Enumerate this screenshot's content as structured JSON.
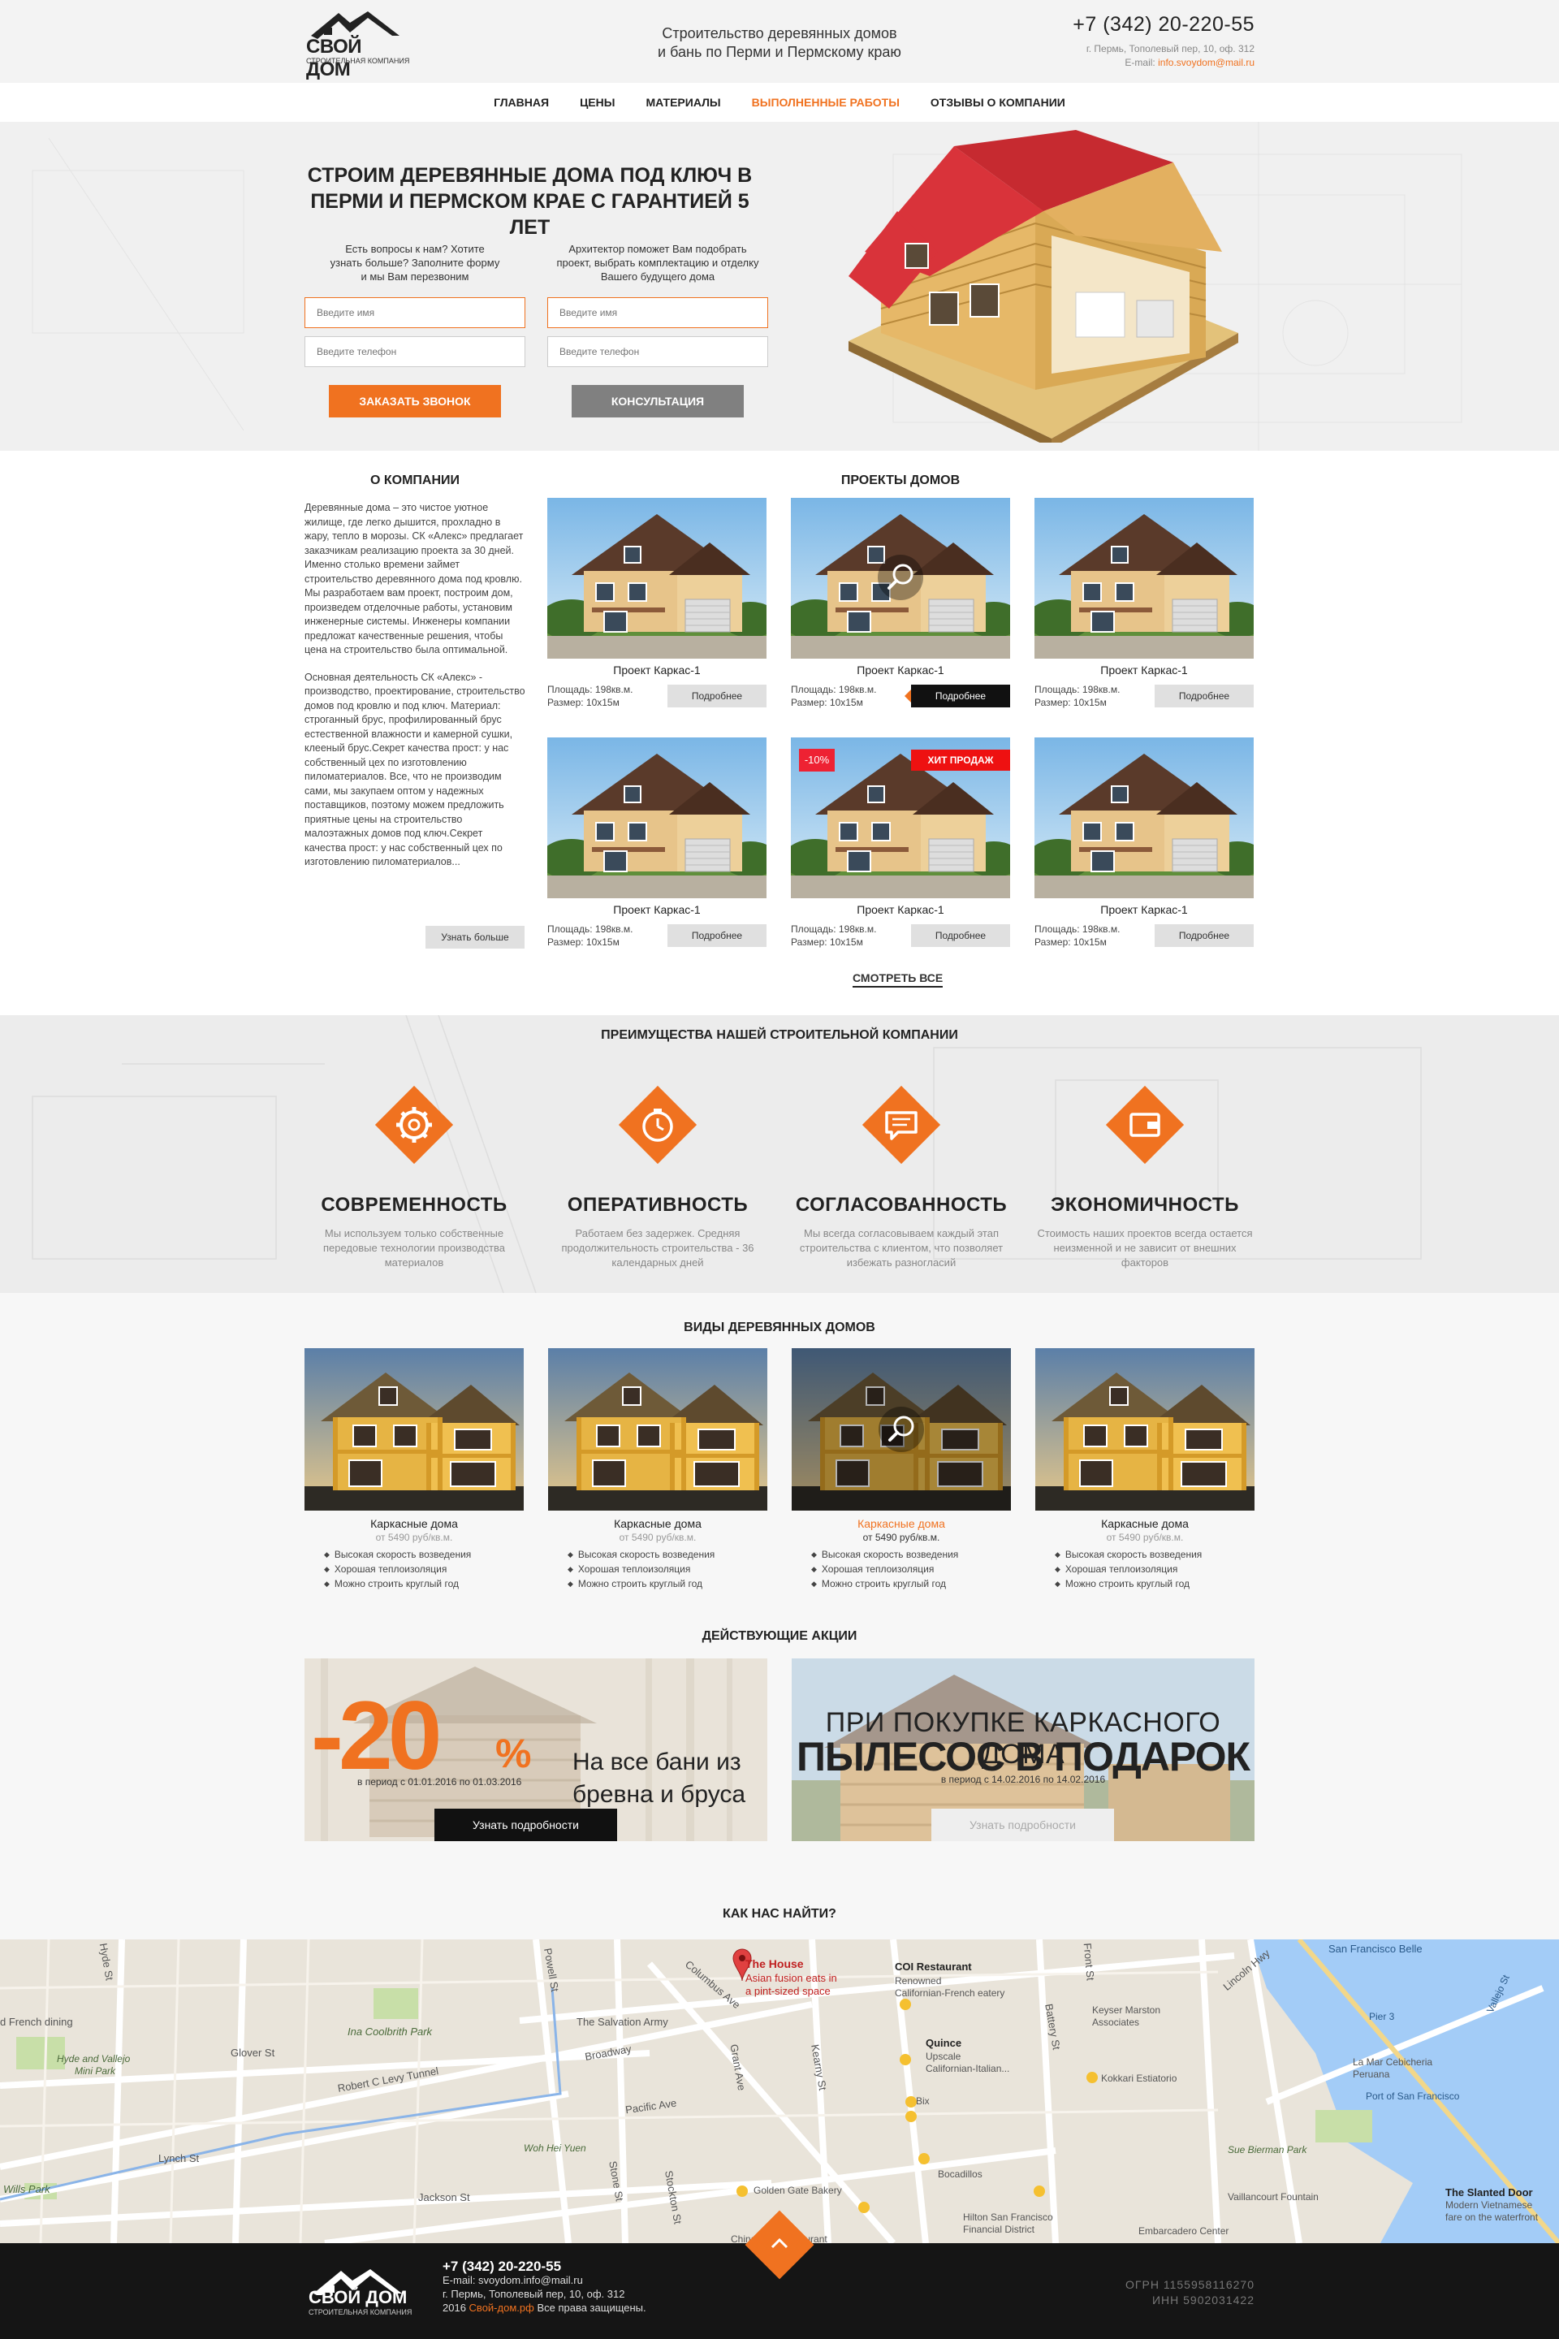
{
  "header": {
    "logo_top": "СВОЙ ДОМ",
    "logo_sub": "СТРОИТЕЛЬНАЯ КОМПАНИЯ",
    "tagline_line1": "Строительство деревянных домов",
    "tagline_line2": "и бань по Перми и Пермскому краю",
    "phone": "+7 (342) 20-220-55",
    "address": "г. Пермь, Тополевый пер, 10, оф. 312",
    "email_label": "E-mail:",
    "email": "info.svoydom@mail.ru"
  },
  "nav": {
    "items": [
      "ГЛАВНАЯ",
      "ЦЕНЫ",
      "МАТЕРИАЛЫ",
      "ВЫПОЛНЕННЫЕ РАБОТЫ",
      "ОТЗЫВЫ О КОМПАНИИ"
    ],
    "active_index": 3
  },
  "hero": {
    "title_line1": "СТРОИМ ДЕРЕВЯННЫЕ ДОМА ПОД КЛЮЧ В",
    "title_line2": "ПЕРМИ И ПЕРМСКОМ КРАЕ С ГАРАНТИЕЙ 5 ЛЕТ",
    "form1": {
      "text": "Есть вопросы к нам? Хотите узнать больше? Заполните форму и мы Вам перезвоним",
      "name_placeholder": "Введите имя",
      "phone_placeholder": "Введите телефон",
      "button": "ЗАКАЗАТЬ ЗВОНОК"
    },
    "form2": {
      "text": "Архитектор поможет Вам подобрать проект, выбрать комплектацию и отделку Вашего будущего дома",
      "name_placeholder": "Введите имя",
      "phone_placeholder": "Введите телефон",
      "button": "КОНСУЛЬТАЦИЯ"
    }
  },
  "about": {
    "title": "О КОМПАНИИ",
    "para1": "Деревянные дома – это чистое уютное жилище, где легко дышится, прохладно в жару, тепло в морозы. СК «Алекс» предлагает заказчикам реализацию проекта за 30 дней. Именно столько времени займет строительство деревянного дома под кровлю. Мы разработаем вам проект, построим дом, произведем отделочные работы, установим инженерные системы. Инженеры компании предложат качественные решения, чтобы цена на строительство была оптимальной.",
    "para2": "Основная деятельность СК «Алекс» - производство, проектирование, строительство домов под кровлю и под ключ. Материал: строганный брус, профилированный брус естественной влажности и камерной сушки, клееный брус.Секрет качества прост: у нас собственный цех по изготовлению пиломатериалов. Все, что не производим сами, мы закупаем оптом у надежных поставщиков, поэтому можем предложить приятные цены на строительство малоэтажных домов под ключ.Секрет качества прост: у нас собственный цех по изготовлению пиломатериалов...",
    "button": "Узнать больше"
  },
  "projects": {
    "title": "ПРОЕКТЫ ДОМОВ",
    "items": [
      {
        "name": "Проект Каркас-1",
        "area": "Площадь: 198кв.м.",
        "size": "Размер: 10х15м",
        "button": "Подробнее"
      },
      {
        "name": "Проект Каркас-1",
        "area": "Площадь: 198кв.м.",
        "size": "Размер: 10х15м",
        "button": "Подробнее"
      },
      {
        "name": "Проект Каркас-1",
        "area": "Площадь: 198кв.м.",
        "size": "Размер: 10х15м",
        "button": "Подробнее"
      },
      {
        "name": "Проект Каркас-1",
        "area": "Площадь: 198кв.м.",
        "size": "Размер: 10х15м",
        "button": "Подробнее"
      },
      {
        "name": "Проект Каркас-1",
        "area": "Площадь: 198кв.м.",
        "size": "Размер: 10х15м",
        "button": "Подробнее",
        "sale_badge": "-10%",
        "hit_badge": "ХИТ ПРОДАЖ"
      },
      {
        "name": "Проект Каркас-1",
        "area": "Площадь: 198кв.м.",
        "size": "Размер: 10х15м",
        "button": "Подробнее"
      }
    ],
    "see_all": "СМОТРЕТЬ ВСЕ"
  },
  "advantages": {
    "title": "ПРЕИМУЩЕСТВА НАШЕЙ СТРОИТЕЛЬНОЙ КОМПАНИИ",
    "items": [
      {
        "icon": "gear-icon",
        "title": "СОВРЕМЕННОСТЬ",
        "text": "Мы используем только собственные передовые технологии производства материалов"
      },
      {
        "icon": "clock-icon",
        "title": "ОПЕРАТИВНОСТЬ",
        "text": "Работаем без задержек. Средняя продолжительность строительства - 36 календарных дней"
      },
      {
        "icon": "chat-icon",
        "title": "СОГЛАСОВАННОСТЬ",
        "text": "Мы всегда согласовываем каждый этап строительства с клиентом, что позволяет избежать разногласий"
      },
      {
        "icon": "wallet-icon",
        "title": "ЭКОНОМИЧНОСТЬ",
        "text": "Стоимость наших проектов всегда остается неизменной и не зависит от внешних факторов"
      }
    ]
  },
  "types": {
    "title": "ВИДЫ ДЕРЕВЯННЫХ ДОМОВ",
    "items": [
      {
        "name": "Каркасные дома",
        "price": "от 5490 руб/кв.м.",
        "features": [
          "Высокая скорость возведения",
          "Хорошая теплоизоляция",
          "Можно строить круглый год"
        ]
      },
      {
        "name": "Каркасные дома",
        "price": "от 5490 руб/кв.м.",
        "features": [
          "Высокая скорость возведения",
          "Хорошая теплоизоляция",
          "Можно строить круглый год"
        ]
      },
      {
        "name": "Каркасные дома",
        "price": "от 5490 руб/кв.м.",
        "features": [
          "Высокая скорость возведения",
          "Хорошая теплоизоляция",
          "Можно строить круглый год"
        ]
      },
      {
        "name": "Каркасные дома",
        "price": "от 5490 руб/кв.м.",
        "features": [
          "Высокая скорость возведения",
          "Хорошая теплоизоляция",
          "Можно строить круглый год"
        ]
      }
    ],
    "highlighted_index": 2
  },
  "promos": {
    "title": "ДЕЙСТВУЮЩИЕ АКЦИИ",
    "promo1": {
      "discount": "-20",
      "percent": "%",
      "text_line1": "На все бани из",
      "text_line2": "бревна и бруса",
      "period": "в период с 01.01.2016 по 01.03.2016",
      "button": "Узнать подробности"
    },
    "promo2": {
      "line1": "ПРИ ПОКУПКЕ КАРКАСНОГО ДОМА",
      "line2": "ПЫЛЕСОС В ПОДАРОК",
      "period": "в период с 14.02.2016 по 14.02.2016",
      "button": "Узнать подробности"
    }
  },
  "map": {
    "title": "КАК НАС НАЙТИ?",
    "pin_title": "The House",
    "pin_desc1": "Asian fusion eats in",
    "pin_desc2": "a pint-sized space",
    "labels": [
      "COI Restaurant",
      "Renowned",
      "Californian-French eatery",
      "Quince",
      "Upscale",
      "Californian-Italian...",
      "Keyser Marston",
      "Associates",
      "La Mar Cebicheria",
      "Peruana",
      "Port of San Francisco",
      "Kokkari Estiatorio",
      "Bix",
      "Golden Gate Bakery",
      "The Salvation Army",
      "Ina Coolbrith Park",
      "Hyde and Vallejo",
      "Mini Park",
      "Robert C Levy Tunnel",
      "Woh Hei Yuen",
      "Chinatown Restaurant",
      "Hilton San Francisco",
      "Financial District",
      "Bocadillos",
      "Sue Bierman Park",
      "Vaillancourt Fountain",
      "Embarcadero Center",
      "The Slanted Door",
      "Modern Vietnamese",
      "fare on the waterfront",
      "Pier 3",
      "San Francisco Belle",
      "Broadway",
      "Pacific Ave",
      "Jackson St",
      "Lynch St",
      "Glover St",
      "Columbus Ave",
      "Grant Ave",
      "Kearny St",
      "Battery St",
      "Front St",
      "Powell St",
      "Stone St",
      "Stockton St",
      "Hyde St",
      "Lincoln Hwy",
      "Vallejo St",
      "d French dining",
      "Wills Park"
    ]
  },
  "footer": {
    "logo_top": "СВОЙ ДОМ",
    "logo_sub": "СТРОИТЕЛЬНАЯ КОМПАНИЯ",
    "phone": "+7 (342) 20-220-55",
    "email": "E-mail: svoydom.info@mail.ru",
    "address": "г. Пермь, Тополевый пер, 10, оф. 312",
    "copyright_year": "2016",
    "copyright_site": "Свой-дом.рф",
    "copyright_rest": "Все права защищены.",
    "ogrn": "ОГРН 1155958116270",
    "inn": "ИНН 5902031422"
  },
  "colors": {
    "accent": "#f07220",
    "dark": "#151515",
    "sale": "#e22233"
  }
}
